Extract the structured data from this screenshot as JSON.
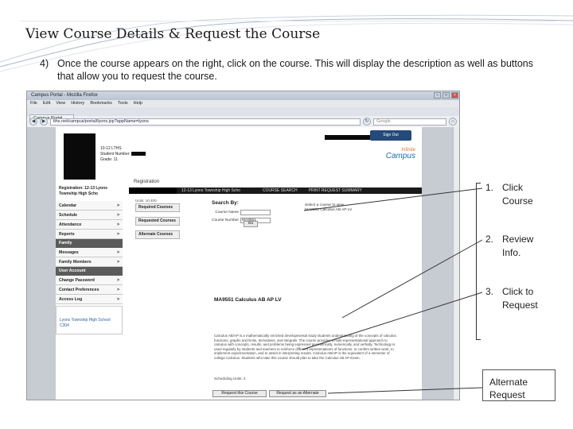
{
  "slide": {
    "title": "View Course Details & Request the Course",
    "step_number": "4)",
    "step_text": "Once the course appears on the right, click on the course. This will display the description as well as buttons that allow you to request the course."
  },
  "browser": {
    "window_title": "Campus Portal - Mozilla Firefox",
    "menu": [
      "File",
      "Edit",
      "View",
      "History",
      "Bookmarks",
      "Tools",
      "Help"
    ],
    "tab_label": "Campus Portal",
    "url": "lths.net/campus/portal/lyons.jsp?appName=lyons",
    "search_placeholder": "Google"
  },
  "portal": {
    "student_grade_line": "10-12 LTHS",
    "student_number_label": "Student Number:",
    "grade_label": "Grade: 11",
    "sign_out": "Sign Out",
    "logo_top": "Infinite",
    "logo_bottom": "Campus",
    "registration_label": "Registration",
    "school_strip": "12-13 Lyons Township High Scho",
    "strip_link_1": "COURSE SEARCH",
    "strip_link_2": "PRINT REQUEST SUMMARY",
    "sidebar_registration": "Registration: 12-13 Lyons Township High Scho",
    "sidebar_items": [
      {
        "label": "Calendar"
      },
      {
        "label": "Schedule"
      },
      {
        "label": "Attendance"
      },
      {
        "label": "Reports"
      }
    ],
    "family_header": "Family",
    "family_items": [
      {
        "label": "Messages"
      },
      {
        "label": "Family Members"
      }
    ],
    "user_header": "User Account",
    "user_items": [
      {
        "label": "Change Password"
      },
      {
        "label": "Contact Preferences"
      },
      {
        "label": "Access Log"
      }
    ],
    "sidebar_footer": "Lyons Township High School C304",
    "units_small": "Units: 10.400",
    "required_courses": "Required Courses",
    "requested_courses": "Requested Courses",
    "alternate_courses": "Alternate Courses",
    "search_heading": "Search By:",
    "course_name_label": "Course Name",
    "course_number_label": "Course Number",
    "course_number_value": "MA9551",
    "go_button": "Go",
    "select_note_1": "Select a course to view",
    "select_note_2": "MA9551 Calculus AB AP LV",
    "course_title": "MA9551 Calculus AB AP LV",
    "description": "Calculus AB/AP is a mathematically enriched developmental study students understanding of the concepts of calculus: functions, graphs and limits, derivatives, and integrals. The course provides a multi-representational approach to calculus with concepts, results, and problems being expressed geometrically, numerically, and verbally. Technology is used regularly by students and teachers to reinforce different representations of functions, to confirm written work, to implement experimentation, and to assist in interpreting results. Calculus AB/AP is the equivalent of a semester of college Calculus. Students who take this course should plan to take the Calculus AB AP Exam.",
    "units": "Scheduling Units: 4",
    "request_button": "Request this Course",
    "alternate_button": "Request as an Alternate"
  },
  "callouts": [
    {
      "num": "1.",
      "line1": "Click",
      "line2": "Course"
    },
    {
      "num": "2.",
      "line1": "Review",
      "line2": "Info."
    },
    {
      "num": "3.",
      "line1": "Click to",
      "line2": "Request"
    }
  ],
  "alternate_callout": {
    "line1": "Alternate",
    "line2": "Request"
  }
}
